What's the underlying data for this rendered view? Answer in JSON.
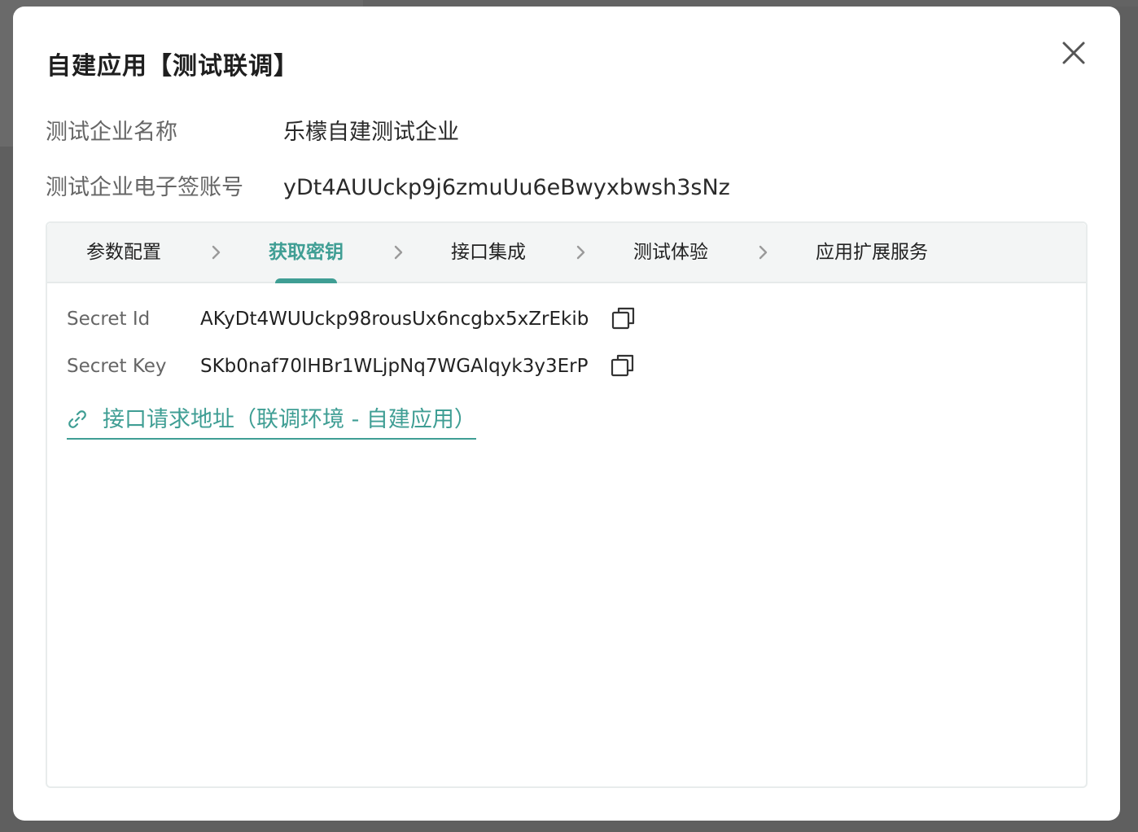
{
  "modal": {
    "title": "自建应用【测试联调】"
  },
  "info": {
    "company_name_label": "测试企业名称",
    "company_name_value": "乐檬自建测试企业",
    "account_label": "测试企业电子签账号",
    "account_value": "yDt4AUUckp9j6zmuUu6eBwyxbwsh3sNz"
  },
  "steps": [
    {
      "label": "参数配置",
      "active": false
    },
    {
      "label": "获取密钥",
      "active": true
    },
    {
      "label": "接口集成",
      "active": false
    },
    {
      "label": "测试体验",
      "active": false
    },
    {
      "label": "应用扩展服务",
      "active": false
    }
  ],
  "secrets": {
    "id_label": "Secret Id",
    "id_value": "AKyDt4WUUckp98rousUx6ncgbx5xZrEkib",
    "key_label": "Secret Key",
    "key_value": "SKb0naf70lHBr1WLjpNq7WGAlqyk3y3ErP"
  },
  "link": {
    "text": "接口请求地址（联调环境 - 自建应用）"
  },
  "colors": {
    "accent": "#3f9e94",
    "overlay": "#5f5f5f"
  },
  "icons": {
    "close": "close-icon",
    "chevron": "chevron-right-icon",
    "copy": "copy-icon",
    "link": "link-icon"
  }
}
